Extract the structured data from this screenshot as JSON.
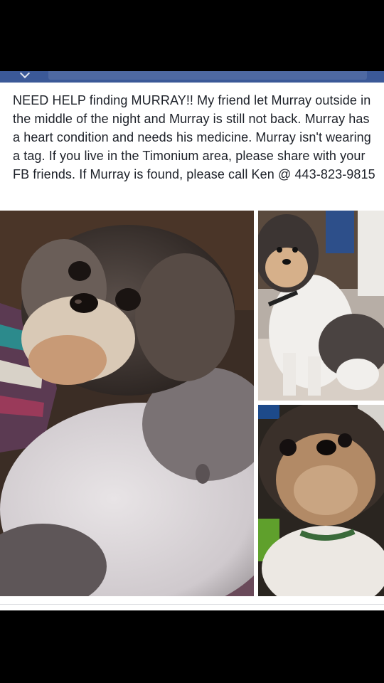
{
  "post": {
    "text": "NEED HELP finding MURRAY!!  My friend let Murray outside in the middle of the night and Murray is still not back.  Murray has a heart condition and needs his medicine.  Murray isn't wearing a tag.  If you live in the Timonium area, please share with your FB friends.   If Murray is found, please call Ken @ 443-823-9815"
  },
  "header": {
    "icons": [
      "back-chevron-icon",
      "search-bar"
    ]
  },
  "colors": {
    "fb_blue": "#3b5998",
    "text": "#1d2129",
    "background": "#ffffff"
  }
}
